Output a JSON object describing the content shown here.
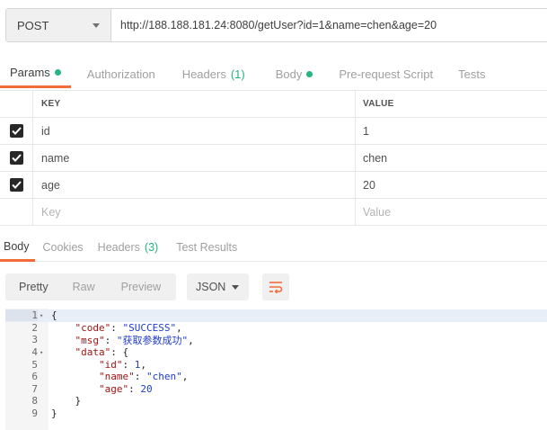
{
  "request": {
    "method": "POST",
    "url": "http://188.188.181.24:8080/getUser?id=1&name=chen&age=20"
  },
  "request_tabs": {
    "params": "Params",
    "authorization": "Authorization",
    "headers": "Headers",
    "headers_count": "(1)",
    "body": "Body",
    "prerequest": "Pre-request Script",
    "tests": "Tests"
  },
  "params": {
    "key_header": "KEY",
    "value_header": "VALUE",
    "rows": [
      {
        "key": "id",
        "value": "1"
      },
      {
        "key": "name",
        "value": "chen"
      },
      {
        "key": "age",
        "value": "20"
      }
    ],
    "key_placeholder": "Key",
    "value_placeholder": "Value"
  },
  "response_tabs": {
    "body": "Body",
    "cookies": "Cookies",
    "headers": "Headers",
    "headers_count": "(3)",
    "test_results": "Test Results"
  },
  "view": {
    "pretty": "Pretty",
    "raw": "Raw",
    "preview": "Preview",
    "format": "JSON"
  },
  "response_lines": [
    {
      "n": "1",
      "fold": true,
      "text": "{"
    },
    {
      "n": "2",
      "text": "    \"code\": \"SUCCESS\","
    },
    {
      "n": "3",
      "text": "    \"msg\": \"获取参数成功\","
    },
    {
      "n": "4",
      "fold": true,
      "text": "    \"data\": {"
    },
    {
      "n": "5",
      "text": "        \"id\": 1,"
    },
    {
      "n": "6",
      "text": "        \"name\": \"chen\","
    },
    {
      "n": "7",
      "text": "        \"age\": 20"
    },
    {
      "n": "8",
      "text": "    }"
    },
    {
      "n": "9",
      "text": "}"
    }
  ],
  "colors": {
    "accent": "#f26b3a",
    "status_green": "#26b47f"
  }
}
